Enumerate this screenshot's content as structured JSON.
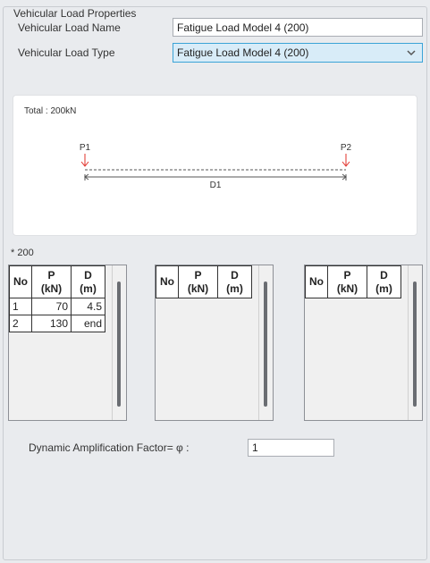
{
  "group": {
    "title": "Vehicular Load Properties"
  },
  "fields": {
    "name_label": "Vehicular Load Name",
    "name_value": "Fatigue Load Model 4 (200)",
    "type_label": "Vehicular Load Type",
    "type_value": "Fatigue Load Model 4 (200)"
  },
  "diagram": {
    "total": "Total : 200kN",
    "loads": [
      "P1",
      "P2"
    ],
    "distance_label": "D1",
    "arrow_color": "#e0302a"
  },
  "section_label": "* 200",
  "tables": {
    "headers": {
      "no": "No",
      "p_top": "P",
      "p_unit": "(kN)",
      "d_top": "D",
      "d_unit": "(m)"
    },
    "table1_rows": [
      {
        "no": "1",
        "p": "70",
        "d": "4.5"
      },
      {
        "no": "2",
        "p": "130",
        "d": "end"
      }
    ]
  },
  "daf": {
    "label": "Dynamic Amplification Factor= φ :",
    "value": "1"
  }
}
